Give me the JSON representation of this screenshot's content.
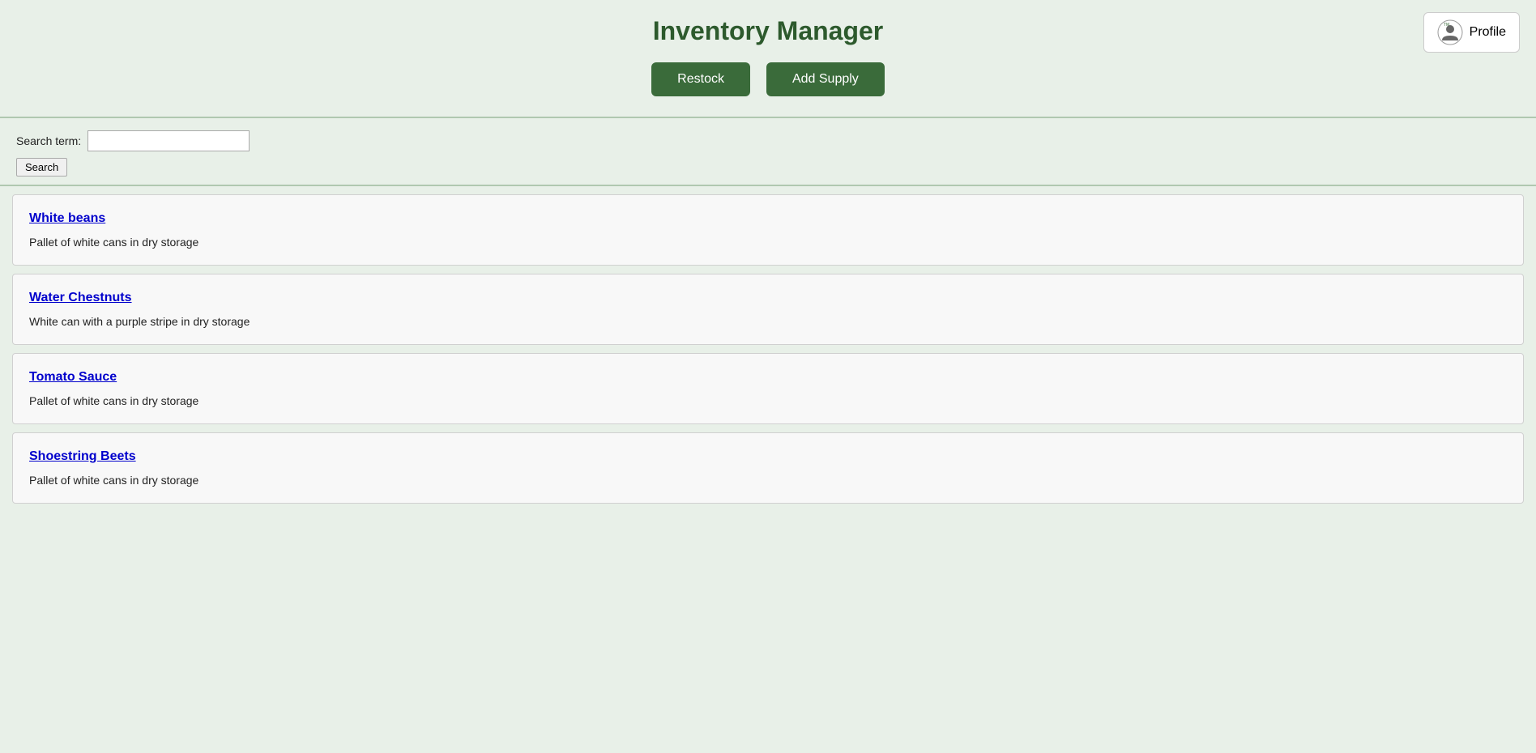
{
  "header": {
    "title": "Inventory Manager",
    "buttons": {
      "restock_label": "Restock",
      "add_supply_label": "Add Supply"
    },
    "profile": {
      "label": "Profile"
    }
  },
  "search": {
    "label": "Search term:",
    "placeholder": "",
    "button_label": "Search"
  },
  "inventory": {
    "items": [
      {
        "name": "White beans",
        "description": "Pallet of white cans in dry storage"
      },
      {
        "name": "Water Chestnuts",
        "description": "White can with a purple stripe in dry storage"
      },
      {
        "name": "Tomato Sauce",
        "description": "Pallet of white cans in dry storage"
      },
      {
        "name": "Shoestring Beets",
        "description": "Pallet of white cans in dry storage"
      }
    ]
  }
}
